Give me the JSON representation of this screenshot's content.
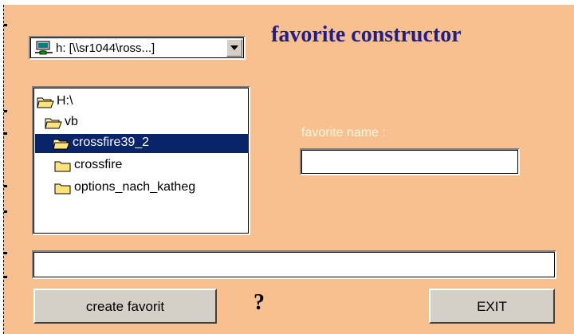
{
  "window": {
    "title": "favorite constructor",
    "background_color": "#f9c08f",
    "title_color": "#1e1e8c"
  },
  "drive": {
    "icon": "network-drive-icon",
    "selected_value": "h: [\\\\sr1044\\ross...]"
  },
  "directory_list": {
    "items": [
      {
        "label": "H:\\",
        "icon": "open-folder-icon",
        "level": 0,
        "selected": false
      },
      {
        "label": "vb",
        "icon": "open-folder-icon",
        "level": 1,
        "selected": false
      },
      {
        "label": "crossfire39_2",
        "icon": "open-folder-icon",
        "level": 2,
        "selected": true
      },
      {
        "label": "crossfire",
        "icon": "folder-icon",
        "level": 3,
        "selected": false
      },
      {
        "label": "options_nach_katheg",
        "icon": "folder-icon",
        "level": 3,
        "selected": false
      }
    ],
    "selection_color": "#0a246a"
  },
  "favorite_name": {
    "label": "favorite name :",
    "value": ""
  },
  "status": {
    "value": ""
  },
  "buttons": {
    "create_label": "create favorit",
    "help_label": "?",
    "exit_label": "EXIT"
  }
}
